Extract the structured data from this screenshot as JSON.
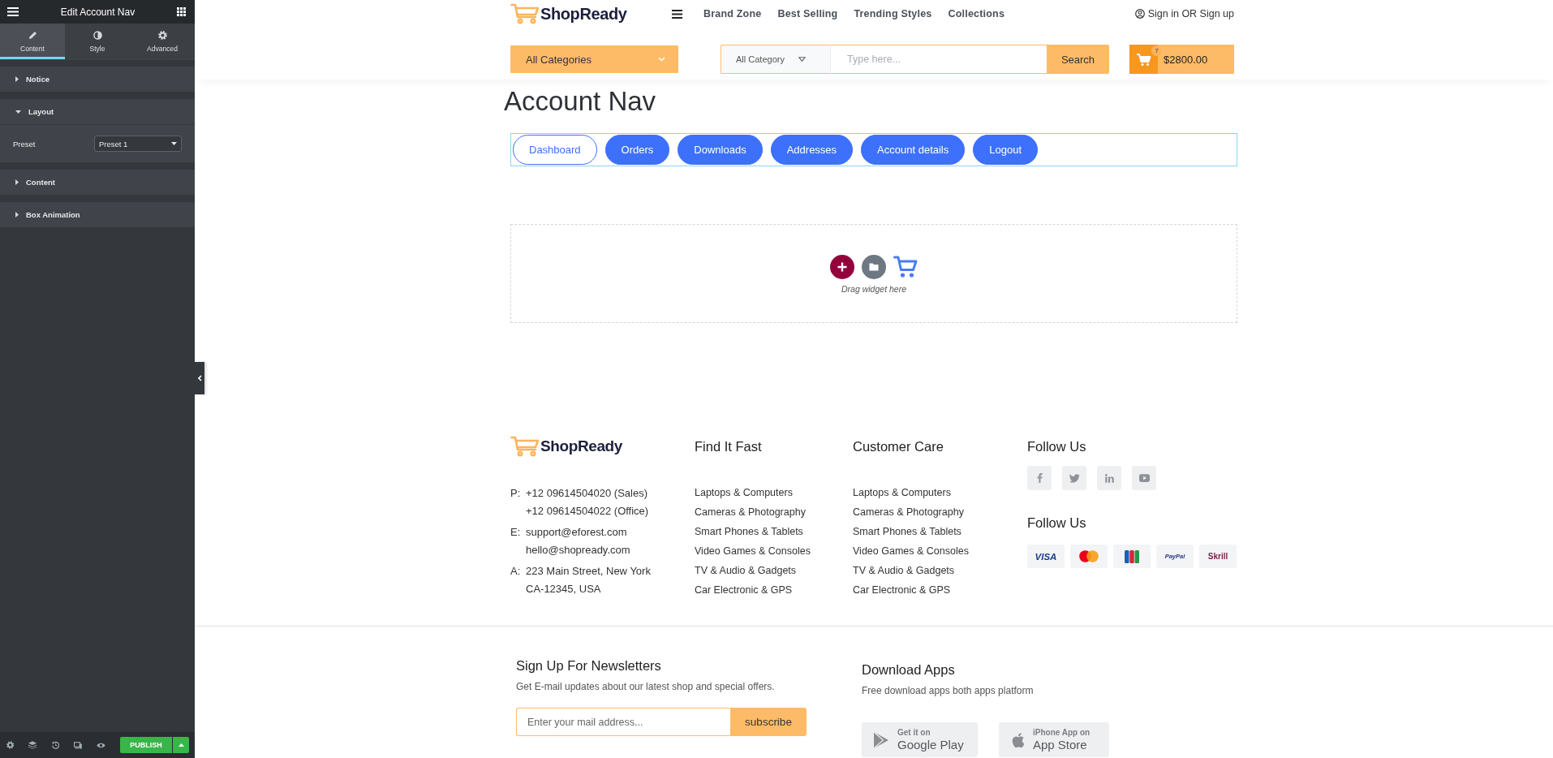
{
  "editor_panel": {
    "title": "Edit Account Nav",
    "tabs": [
      {
        "label": "Content",
        "selected": true
      },
      {
        "label": "Style",
        "selected": false
      },
      {
        "label": "Advanced",
        "selected": false
      }
    ],
    "sections": [
      {
        "title": "Notice",
        "expanded": false
      },
      {
        "title": "Layout",
        "expanded": true,
        "fields": [
          {
            "label": "Preset",
            "value": "Preset 1"
          }
        ]
      },
      {
        "title": "Content",
        "expanded": false
      },
      {
        "title": "Box Animation",
        "expanded": false
      }
    ],
    "publish_button": "PUBLISH"
  },
  "header": {
    "logo": "ShopReady",
    "nav": [
      "Brand Zone",
      "Best Selling",
      "Trending Styles",
      "Collections"
    ],
    "account_link": "Sign in OR Sign up",
    "categories": "All Categories",
    "search": {
      "category": "All Category",
      "placeholder": "Type here...",
      "button": "Search"
    },
    "cart": {
      "count": "7",
      "total": "$2800.00"
    }
  },
  "page_title": "Account Nav",
  "account_nav": [
    {
      "label": "Dashboard",
      "selected": true
    },
    {
      "label": "Orders",
      "selected": false
    },
    {
      "label": "Downloads",
      "selected": false
    },
    {
      "label": "Addresses",
      "selected": false
    },
    {
      "label": "Account details",
      "selected": false
    },
    {
      "label": "Logout",
      "selected": false
    }
  ],
  "drop_zone": {
    "hint": "Drag widget here"
  },
  "footer": {
    "logo": "ShopReady",
    "contact": [
      {
        "prefix": "P:",
        "lines": [
          "+12 09614504020 (Sales)",
          "+12 09614504022 (Office)"
        ]
      },
      {
        "prefix": "E:",
        "lines": [
          "support@eforest.com",
          "hello@shopready.com"
        ]
      },
      {
        "prefix": "A:",
        "lines": [
          "223 Main Street, New York",
          "CA-12345, USA"
        ]
      }
    ],
    "columns": [
      {
        "title": "Find It Fast",
        "links": [
          "Laptops & Computers",
          "Cameras & Photography",
          "Smart Phones & Tablets",
          "Video Games & Consoles",
          "TV & Audio & Gadgets",
          "Car Electronic & GPS"
        ]
      },
      {
        "title": "Customer Care",
        "links": [
          "Laptops & Computers",
          "Cameras & Photography",
          "Smart Phones & Tablets",
          "Video Games & Consoles",
          "TV & Audio & Gadgets",
          "Car Electronic & GPS"
        ]
      }
    ],
    "social": {
      "title": "Follow Us"
    },
    "payments": {
      "title": "Follow Us",
      "methods": [
        {
          "kind": "wordmark",
          "label": "VISA",
          "color": "#1a3e8c"
        },
        {
          "kind": "circles"
        },
        {
          "kind": "stripes"
        },
        {
          "kind": "wordmark",
          "label": "PayPal",
          "color": "#253b80"
        },
        {
          "kind": "wordmark",
          "label": "Skrill",
          "color": "#7a1f4a"
        }
      ]
    }
  },
  "newsletter": {
    "title": "Sign Up For Newsletters",
    "description": "Get E-mail updates about our latest shop and special offers.",
    "placeholder": "Enter your mail address...",
    "button": "subscribe"
  },
  "apps": {
    "title": "Download Apps",
    "description": "Free download apps both apps platform",
    "stores": [
      {
        "caption": "Get it on",
        "name": "Google Play"
      },
      {
        "caption": "iPhone App on",
        "name": "App Store"
      }
    ]
  }
}
